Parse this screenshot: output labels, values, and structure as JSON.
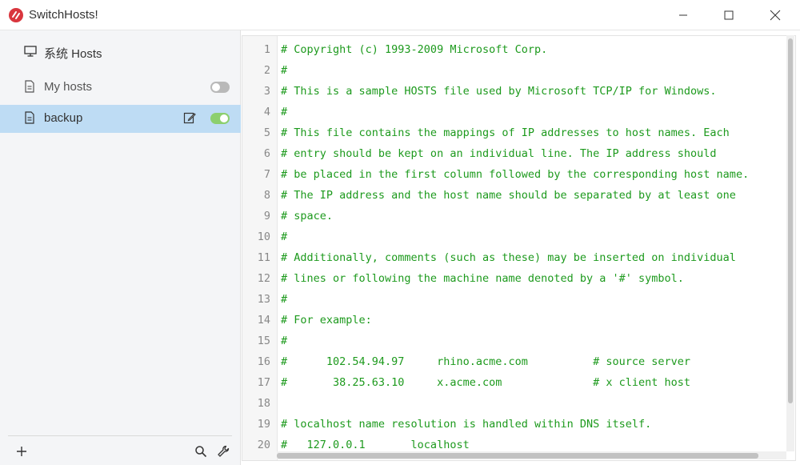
{
  "window": {
    "title": "SwitchHosts!",
    "accent_color": "#d9363e"
  },
  "sidebar": {
    "items": [
      {
        "label": "系统 Hosts",
        "icon": "monitor-icon"
      },
      {
        "label": "My hosts",
        "icon": "file-icon",
        "enabled": false
      },
      {
        "label": "backup",
        "icon": "file-icon",
        "enabled": true,
        "selected": true
      }
    ],
    "selected_color": "#bedcf4",
    "toggle_on_color": "#8ccf6e"
  },
  "editor": {
    "text_color": "#1d9a1d",
    "lines": [
      "# Copyright (c) 1993-2009 Microsoft Corp.",
      "#",
      "# This is a sample HOSTS file used by Microsoft TCP/IP for Windows.",
      "#",
      "# This file contains the mappings of IP addresses to host names. Each",
      "# entry should be kept on an individual line. The IP address should",
      "# be placed in the first column followed by the corresponding host name.",
      "# The IP address and the host name should be separated by at least one",
      "# space.",
      "#",
      "# Additionally, comments (such as these) may be inserted on individual",
      "# lines or following the machine name denoted by a '#' symbol.",
      "#",
      "# For example:",
      "#",
      "#      102.54.94.97     rhino.acme.com          # source server",
      "#       38.25.63.10     x.acme.com              # x client host",
      "",
      "# localhost name resolution is handled within DNS itself.",
      "#   127.0.0.1       localhost"
    ],
    "line_numbers": [
      "1",
      "2",
      "3",
      "4",
      "5",
      "6",
      "7",
      "8",
      "9",
      "10",
      "11",
      "12",
      "13",
      "14",
      "15",
      "16",
      "17",
      "18",
      "19",
      "20"
    ]
  },
  "footer": {
    "add_icon": "plus-icon",
    "search_icon": "search-icon",
    "settings_icon": "wrench-icon"
  }
}
